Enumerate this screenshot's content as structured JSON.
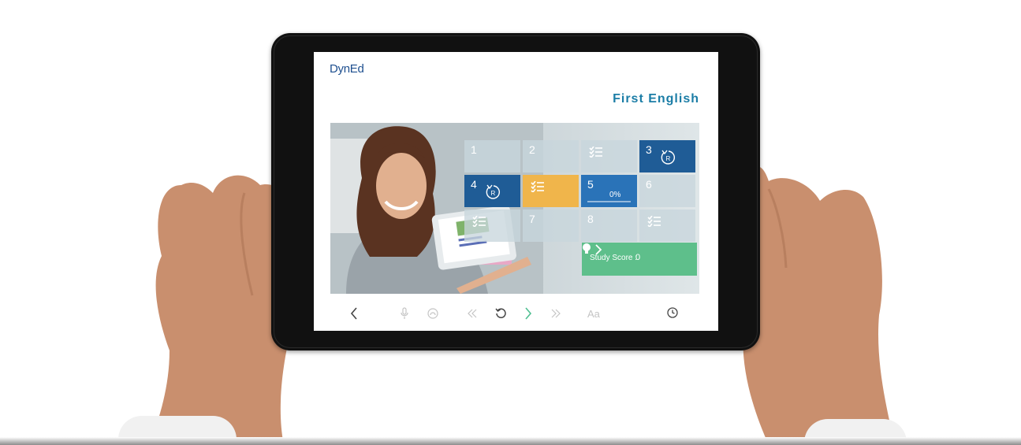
{
  "app": {
    "logo": "DynEd",
    "title": "First English"
  },
  "lessons": [
    {
      "label": "1",
      "state": "default"
    },
    {
      "label": "2",
      "state": "default"
    },
    {
      "label": "",
      "state": "checklist"
    },
    {
      "label": "3",
      "state": "review"
    },
    {
      "label": "4",
      "state": "review"
    },
    {
      "label": "",
      "state": "checklist-active"
    },
    {
      "label": "5",
      "state": "in-progress",
      "progress_text": "0%",
      "progress": 0
    },
    {
      "label": "6",
      "state": "default"
    },
    {
      "label": "",
      "state": "checklist"
    },
    {
      "label": "7",
      "state": "default"
    },
    {
      "label": "8",
      "state": "default"
    },
    {
      "label": "",
      "state": "checklist"
    }
  ],
  "study_score": {
    "label": "Study Score :",
    "value": "0"
  },
  "toolbar": {
    "font_size_label": "Aa"
  },
  "colors": {
    "accent": "#1b7da6",
    "tile_blue": "#1f5c96",
    "tile_orange": "#f0b54b",
    "score_green": "#5ebf8b",
    "next_green": "#4fbf91"
  }
}
